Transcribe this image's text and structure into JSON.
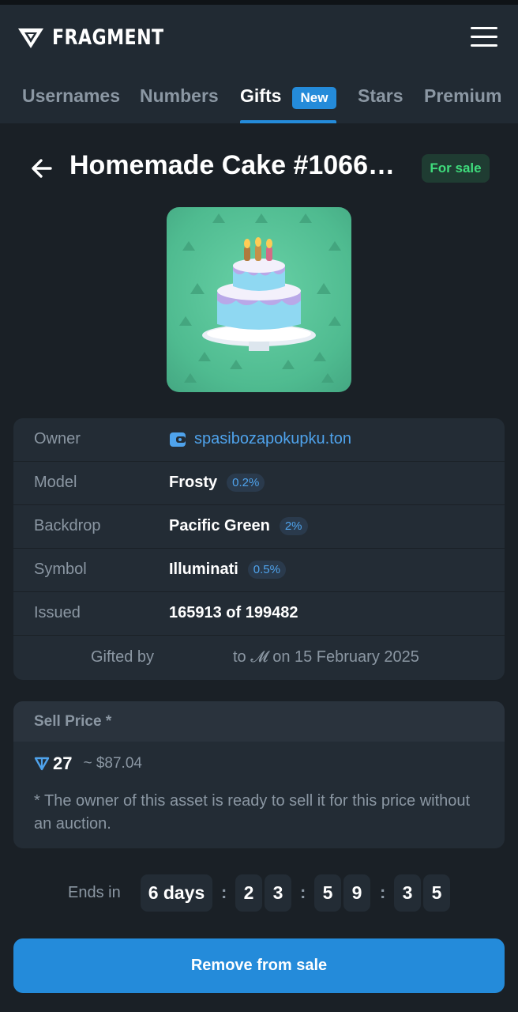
{
  "app": {
    "name": "FRAGMENT"
  },
  "tabs": [
    {
      "label": "Usernames"
    },
    {
      "label": "Numbers"
    },
    {
      "label": "Gifts",
      "badge": "New",
      "active": true
    },
    {
      "label": "Stars"
    },
    {
      "label": "Premium"
    }
  ],
  "gift": {
    "title": "Homemade Cake #1066…",
    "status": "For sale"
  },
  "details": {
    "owner": {
      "label": "Owner",
      "value": "spasibozapokupku.ton"
    },
    "model": {
      "label": "Model",
      "value": "Frosty",
      "percent": "0.2%"
    },
    "backdrop": {
      "label": "Backdrop",
      "value": "Pacific Green",
      "percent": "2%"
    },
    "symbol": {
      "label": "Symbol",
      "value": "Illuminati",
      "percent": "0.5%"
    },
    "issued": {
      "label": "Issued",
      "value": "165913 of 199482"
    },
    "gifted": {
      "prefix": "Gifted by",
      "suffix": "to 𝓜 on 15 February 2025"
    }
  },
  "price": {
    "heading": "Sell Price *",
    "ton": "27",
    "usd": "~ $87.04",
    "note": "* The owner of this asset is ready to sell it for this price without an auction."
  },
  "timer": {
    "label": "Ends in",
    "days": "6 days",
    "hours": [
      "2",
      "3"
    ],
    "minutes": [
      "5",
      "9"
    ],
    "seconds": [
      "3",
      "5"
    ],
    "separator": ":"
  },
  "actions": {
    "remove_label": "Remove from sale"
  },
  "colors": {
    "accent": "#248bda",
    "background": "#1a2026",
    "panel": "#232c35",
    "status_green": "#3fdc7c",
    "backdrop_green": "#4fbb90"
  }
}
